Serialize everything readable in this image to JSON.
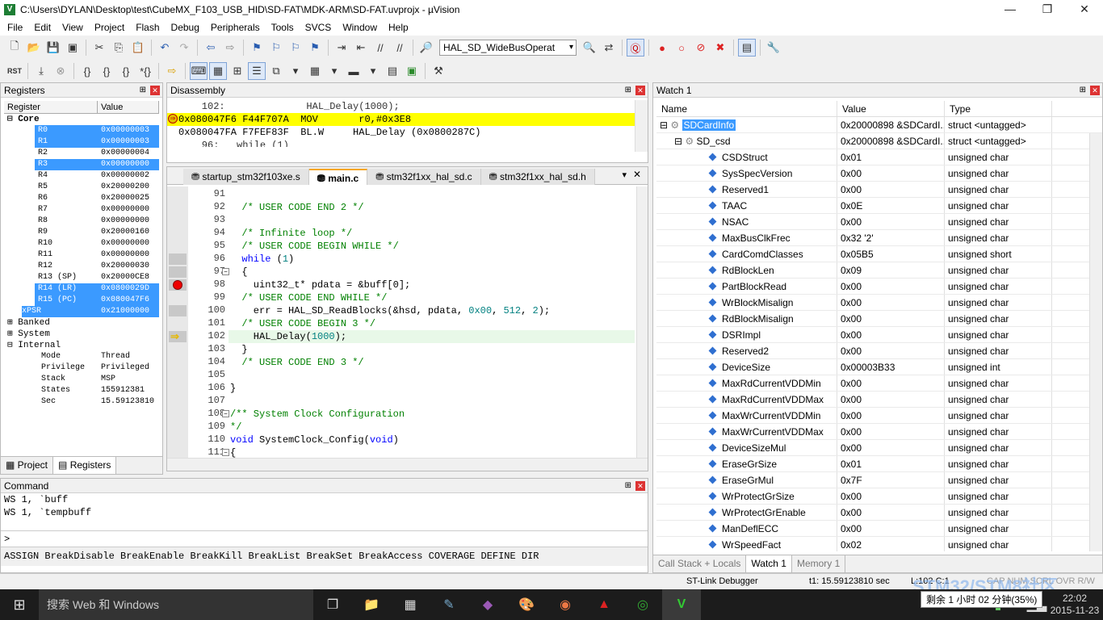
{
  "window": {
    "title": "C:\\Users\\DYLAN\\Desktop\\test\\CubeMX_F103_USB_HID\\SD-FAT\\MDK-ARM\\SD-FAT.uvprojx - µVision",
    "icon": "V"
  },
  "menu": [
    "File",
    "Edit",
    "View",
    "Project",
    "Flash",
    "Debug",
    "Peripherals",
    "Tools",
    "SVCS",
    "Window",
    "Help"
  ],
  "toolbar": {
    "combo": "HAL_SD_WideBusOperat"
  },
  "registers": {
    "title": "Registers",
    "col_register": "Register",
    "col_value": "Value",
    "core": "Core",
    "rows": [
      {
        "n": "R0",
        "v": "0x00000003"
      },
      {
        "n": "R1",
        "v": "0x00000003"
      },
      {
        "n": "R2",
        "v": "0x00000004"
      },
      {
        "n": "R3",
        "v": "0x00000000"
      },
      {
        "n": "R4",
        "v": "0x00000002"
      },
      {
        "n": "R5",
        "v": "0x20000200"
      },
      {
        "n": "R6",
        "v": "0x20000025"
      },
      {
        "n": "R7",
        "v": "0x00000000"
      },
      {
        "n": "R8",
        "v": "0x00000000"
      },
      {
        "n": "R9",
        "v": "0x20000160"
      },
      {
        "n": "R10",
        "v": "0x00000000"
      },
      {
        "n": "R11",
        "v": "0x00000000"
      },
      {
        "n": "R12",
        "v": "0x20000030"
      },
      {
        "n": "R13 (SP)",
        "v": "0x20000CE8"
      },
      {
        "n": "R14 (LR)",
        "v": "0x0800029D"
      },
      {
        "n": "R15 (PC)",
        "v": "0x080047F6"
      },
      {
        "n": "xPSR",
        "v": "0x21000000"
      }
    ],
    "groups": [
      "Banked",
      "System",
      "Internal"
    ],
    "internal": [
      {
        "n": "Mode",
        "v": "Thread"
      },
      {
        "n": "Privilege",
        "v": "Privileged"
      },
      {
        "n": "Stack",
        "v": "MSP"
      },
      {
        "n": "States",
        "v": "155912381"
      },
      {
        "n": "Sec",
        "v": "15.59123810"
      }
    ],
    "tab_project": "Project",
    "tab_registers": "Registers"
  },
  "disassembly": {
    "title": "Disassembly",
    "lines": [
      "    102:              HAL_Delay(1000);",
      "0x080047F6 F44F707A  MOV       r0,#0x3E8",
      "0x080047FA F7FEF83F  BL.W     HAL_Delay (0x0800287C)",
      "    96:   while (1)"
    ]
  },
  "editor": {
    "tabs": [
      "startup_stm32f103xe.s",
      "main.c",
      "stm32f1xx_hal_sd.c",
      "stm32f1xx_hal_sd.h"
    ],
    "lines": [
      {
        "no": "91",
        "t": ""
      },
      {
        "no": "92",
        "t": "  /* USER CODE END 2 */"
      },
      {
        "no": "93",
        "t": ""
      },
      {
        "no": "94",
        "t": "  /* Infinite loop */"
      },
      {
        "no": "95",
        "t": "  /* USER CODE BEGIN WHILE */"
      },
      {
        "no": "96",
        "t": "  while (1)"
      },
      {
        "no": "97",
        "t": "  {"
      },
      {
        "no": "98",
        "t": "    uint32_t* pdata = &buff[0];"
      },
      {
        "no": "99",
        "t": "  /* USER CODE END WHILE */"
      },
      {
        "no": "100",
        "t": "    err = HAL_SD_ReadBlocks(&hsd, pdata, 0x00, 512, 2);"
      },
      {
        "no": "101",
        "t": "  /* USER CODE BEGIN 3 */"
      },
      {
        "no": "102",
        "t": "    HAL_Delay(1000);"
      },
      {
        "no": "103",
        "t": "  }"
      },
      {
        "no": "104",
        "t": "  /* USER CODE END 3 */"
      },
      {
        "no": "105",
        "t": ""
      },
      {
        "no": "106",
        "t": "}"
      },
      {
        "no": "107",
        "t": ""
      },
      {
        "no": "108",
        "t": "/** System Clock Configuration"
      },
      {
        "no": "109",
        "t": "*/"
      },
      {
        "no": "110",
        "t": "void SystemClock_Config(void)"
      },
      {
        "no": "111",
        "t": "{"
      }
    ]
  },
  "command": {
    "title": "Command",
    "lines": [
      "WS 1, `buff",
      "WS 1, `tempbuff"
    ],
    "prompt": ">",
    "hint": "ASSIGN BreakDisable BreakEnable BreakKill BreakList BreakSet BreakAccess COVERAGE DEFINE DIR"
  },
  "watch": {
    "title": "Watch 1",
    "col_name": "Name",
    "col_value": "Value",
    "col_type": "Type",
    "root": {
      "n": "SDCardInfo",
      "v": "0x20000898 &SDCardI...",
      "t": "struct <untagged>"
    },
    "child": {
      "n": "SD_csd",
      "v": "0x20000898 &SDCardI...",
      "t": "struct <untagged>"
    },
    "rows": [
      {
        "n": "CSDStruct",
        "v": "0x01",
        "t": "unsigned char"
      },
      {
        "n": "SysSpecVersion",
        "v": "0x00",
        "t": "unsigned char"
      },
      {
        "n": "Reserved1",
        "v": "0x00",
        "t": "unsigned char"
      },
      {
        "n": "TAAC",
        "v": "0x0E",
        "t": "unsigned char"
      },
      {
        "n": "NSAC",
        "v": "0x00",
        "t": "unsigned char"
      },
      {
        "n": "MaxBusClkFrec",
        "v": "0x32 '2'",
        "t": "unsigned char"
      },
      {
        "n": "CardComdClasses",
        "v": "0x05B5",
        "t": "unsigned short"
      },
      {
        "n": "RdBlockLen",
        "v": "0x09",
        "t": "unsigned char"
      },
      {
        "n": "PartBlockRead",
        "v": "0x00",
        "t": "unsigned char"
      },
      {
        "n": "WrBlockMisalign",
        "v": "0x00",
        "t": "unsigned char"
      },
      {
        "n": "RdBlockMisalign",
        "v": "0x00",
        "t": "unsigned char"
      },
      {
        "n": "DSRImpl",
        "v": "0x00",
        "t": "unsigned char"
      },
      {
        "n": "Reserved2",
        "v": "0x00",
        "t": "unsigned char"
      },
      {
        "n": "DeviceSize",
        "v": "0x00003B33",
        "t": "unsigned int"
      },
      {
        "n": "MaxRdCurrentVDDMin",
        "v": "0x00",
        "t": "unsigned char"
      },
      {
        "n": "MaxRdCurrentVDDMax",
        "v": "0x00",
        "t": "unsigned char"
      },
      {
        "n": "MaxWrCurrentVDDMin",
        "v": "0x00",
        "t": "unsigned char"
      },
      {
        "n": "MaxWrCurrentVDDMax",
        "v": "0x00",
        "t": "unsigned char"
      },
      {
        "n": "DeviceSizeMul",
        "v": "0x00",
        "t": "unsigned char"
      },
      {
        "n": "EraseGrSize",
        "v": "0x01",
        "t": "unsigned char"
      },
      {
        "n": "EraseGrMul",
        "v": "0x7F",
        "t": "unsigned char"
      },
      {
        "n": "WrProtectGrSize",
        "v": "0x00",
        "t": "unsigned char"
      },
      {
        "n": "WrProtectGrEnable",
        "v": "0x00",
        "t": "unsigned char"
      },
      {
        "n": "ManDeflECC",
        "v": "0x00",
        "t": "unsigned char"
      },
      {
        "n": "WrSpeedFact",
        "v": "0x02",
        "t": "unsigned char"
      }
    ],
    "tabs": [
      "Call Stack + Locals",
      "Watch 1",
      "Memory 1"
    ]
  },
  "status": {
    "debugger": "ST-Link Debugger",
    "time": "t1: 15.59123810 sec",
    "pos": "L:102 C:1",
    "caps": "CAP  NUM  SCRL  OVR  R/W"
  },
  "taskbar": {
    "search": "搜索 Web 和 Windows",
    "battery_tip": "剩余 1 小时 02 分钟(35%)",
    "time": "22:02",
    "date": "2015-11-23",
    "watermark": "STM32/STM8社区"
  }
}
